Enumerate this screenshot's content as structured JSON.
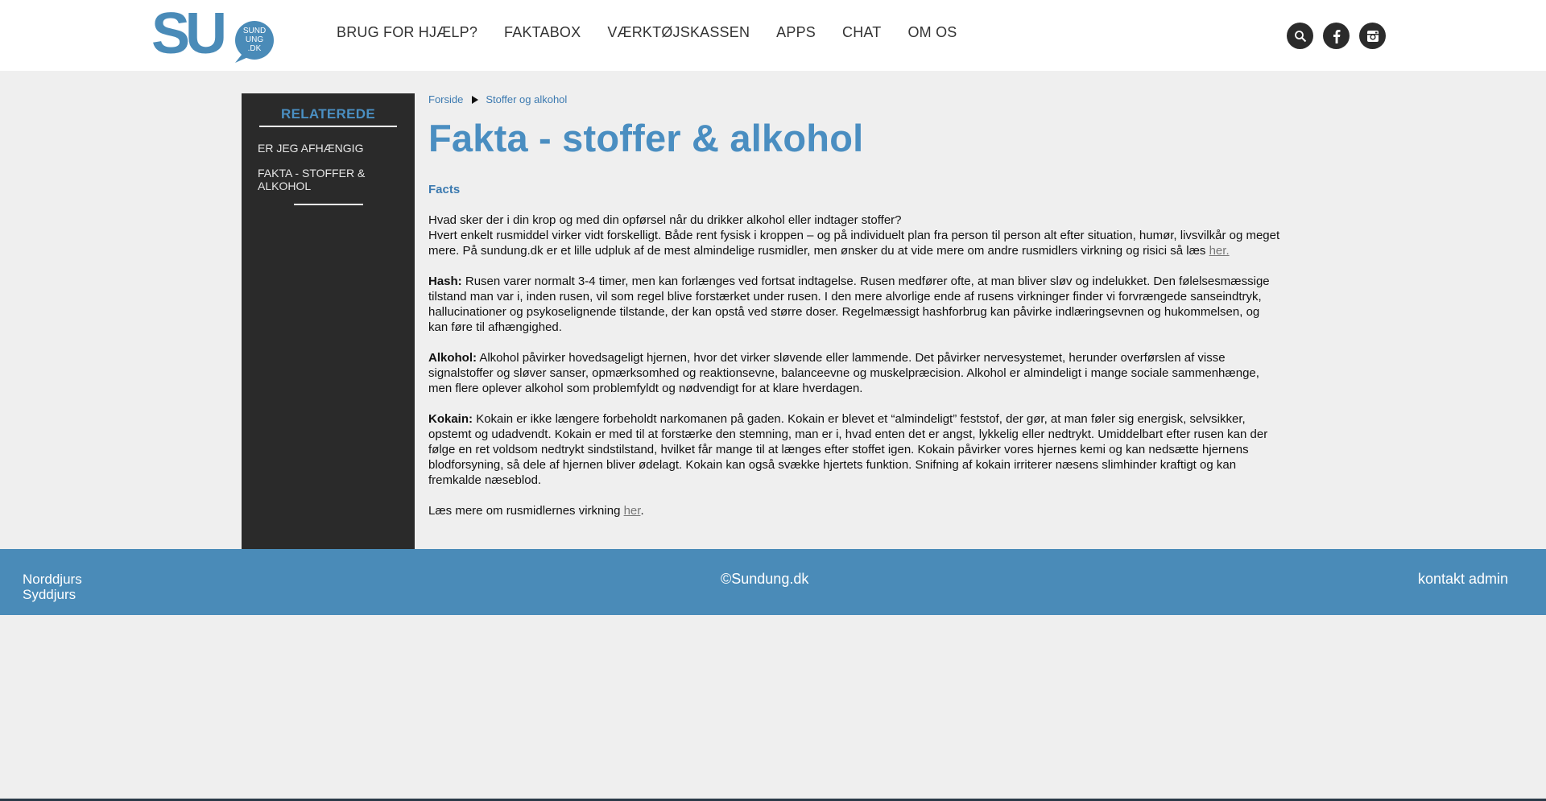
{
  "header": {
    "logo_text": "SU",
    "logo_sub": [
      "SUND",
      "UNG",
      ".DK"
    ],
    "nav": [
      "BRUG FOR HJÆLP?",
      "FAKTABOX",
      "VÆRKTØJSKASSEN",
      "APPS",
      "CHAT",
      "OM OS"
    ],
    "icons": [
      "search-icon",
      "facebook-icon",
      "instagram-icon"
    ]
  },
  "sidebar": {
    "title": "RELATEREDE",
    "items": [
      "ER JEG AFHÆNGIG",
      "FAKTA - STOFFER & ALKOHOL"
    ]
  },
  "breadcrumb": [
    "Forside",
    "Stoffer og alkohol"
  ],
  "page": {
    "title": "Fakta - stoffer & alkohol",
    "subhead": "Facts",
    "intro_question": "Hvad sker der i din krop og med din opførsel når du drikker alkohol eller indtager stoffer?",
    "intro_text": "Hvert enkelt rusmiddel virker vidt forskelligt. Både rent fysisk i kroppen – og på individuelt plan fra person til person alt efter situation, humør, livsvilkår og meget mere. På sundung.dk er et lille udpluk af de mest almindelige rusmidler, men ønsker du at vide mere om andre rusmidlers virkning og risici så læs",
    "intro_link": "her.",
    "hash_label": "Hash:",
    "hash_text": "Rusen varer normalt 3-4 timer, men kan forlænges ved fortsat indtagelse. Rusen medfører ofte, at man bliver sløv og indelukket. Den følelsesmæssige tilstand man var i, inden rusen, vil som regel blive forstærket under rusen. I den mere alvorlige ende af rusens virkninger finder vi forvrængede sanseindtryk, hallucinationer og psykoselignende tilstande, der kan opstå ved større doser. Regelmæssigt hashforbrug kan påvirke indlæringsevnen og hukommelsen, og kan føre til afhængighed.",
    "alkohol_label": "Alkohol:",
    "alkohol_text": "Alkohol påvirker hovedsageligt hjernen, hvor det virker sløvende eller lammende. Det påvirker nervesystemet, herunder overførslen af visse signalstoffer og sløver sanser, opmærksomhed og reaktionsevne, balanceevne og muskelpræcision. Alkohol er almindeligt i mange sociale sammenhænge, men flere oplever alkohol som problemfyldt og nødvendigt for at klare hverdagen.",
    "kokain_label": "Kokain:",
    "kokain_text": "Kokain er ikke længere forbeholdt narkomanen på gaden. Kokain er blevet et “almindeligt” feststof, der gør, at man føler sig energisk, selvsikker, opstemt og udadvendt. Kokain er med til at forstærke den stemning, man er i, hvad enten det er angst, lykkelig eller nedtrykt. Umiddelbart efter rusen kan der følge en ret voldsom nedtrykt sindstilstand, hvilket får mange til at længes efter stoffet igen. Kokain påvirker vores hjernes kemi og kan nedsætte hjernens blodforsyning, så dele af hjernen bliver ødelagt. Kokain kan også svække hjertets funktion. Snifning af kokain irriterer næsens slimhinder kraftigt og kan fremkalde næseblod.",
    "outro_text": "Læs mere om rusmidlernes virkning",
    "outro_link": "her",
    "outro_end": "."
  },
  "footer": {
    "left": [
      "Norddjurs",
      "Syddjurs"
    ],
    "center": "©Sundung.dk",
    "right": "kontakt admin"
  },
  "colors": {
    "accent": "#4a8ec1",
    "sidebar_bg": "#2a2a2a",
    "footer_bg": "#4a8bb8",
    "page_bg": "#efefef"
  }
}
